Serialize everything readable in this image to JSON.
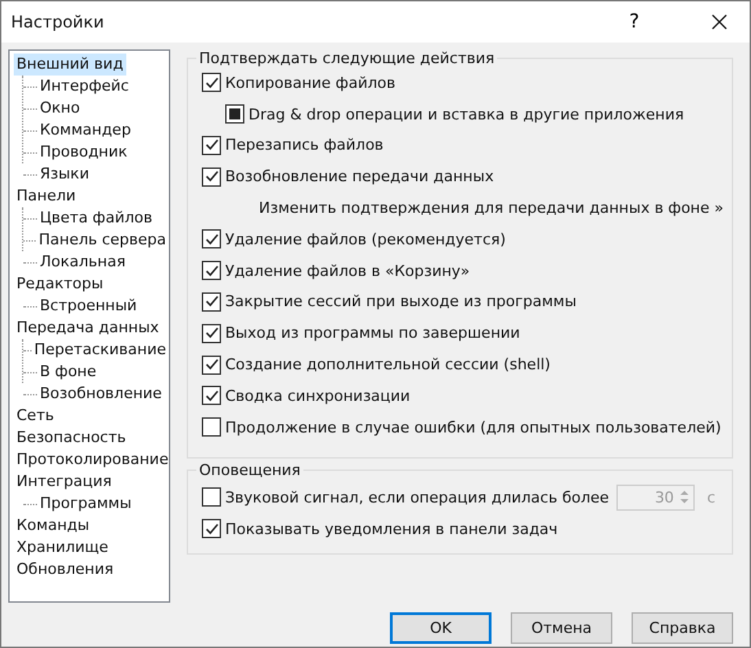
{
  "window": {
    "title": "Настройки",
    "help_button": "?"
  },
  "tree": [
    {
      "label": "Внешний вид",
      "selected": true,
      "children": [
        {
          "label": "Интерфейс",
          "selected": false
        },
        {
          "label": "Окно",
          "selected": false
        },
        {
          "label": "Коммандер",
          "selected": false
        },
        {
          "label": "Проводник",
          "selected": false
        },
        {
          "label": "Языки",
          "selected": false
        }
      ]
    },
    {
      "label": "Панели",
      "selected": false,
      "children": [
        {
          "label": "Цвета файлов",
          "selected": false
        },
        {
          "label": "Панель сервера",
          "selected": false
        },
        {
          "label": "Локальная",
          "selected": false
        }
      ]
    },
    {
      "label": "Редакторы",
      "selected": false,
      "children": [
        {
          "label": "Встроенный",
          "selected": false
        }
      ]
    },
    {
      "label": "Передача данных",
      "selected": false,
      "children": [
        {
          "label": "Перетаскивание",
          "selected": false
        },
        {
          "label": "В фоне",
          "selected": false
        },
        {
          "label": "Возобновление",
          "selected": false
        }
      ]
    },
    {
      "label": "Сеть",
      "selected": false
    },
    {
      "label": "Безопасность",
      "selected": false
    },
    {
      "label": "Протоколирование",
      "selected": false
    },
    {
      "label": "Интеграция",
      "selected": false,
      "children": [
        {
          "label": "Программы",
          "selected": false
        }
      ]
    },
    {
      "label": "Команды",
      "selected": false
    },
    {
      "label": "Хранилище",
      "selected": false
    },
    {
      "label": "Обновления",
      "selected": false
    }
  ],
  "confirm_group": {
    "title": "Подтверждать следующие действия",
    "items": [
      {
        "kind": "checkbox",
        "label": "Копирование файлов",
        "checked": true
      },
      {
        "kind": "sub-checkbox",
        "label": "Drag & drop операции и вставка в другие приложения",
        "checked": true
      },
      {
        "kind": "checkbox",
        "label": "Перезапись файлов",
        "checked": true
      },
      {
        "kind": "checkbox",
        "label": "Возобновление передачи данных",
        "checked": true
      },
      {
        "kind": "link",
        "label": "Изменить подтверждения для передачи данных в фоне »"
      },
      {
        "kind": "checkbox",
        "label": "Удаление файлов (рекомендуется)",
        "checked": true
      },
      {
        "kind": "checkbox",
        "label": "Удаление файлов в «Корзину»",
        "checked": true
      },
      {
        "kind": "checkbox",
        "label": "Закрытие сессий при выходе из программы",
        "checked": true
      },
      {
        "kind": "checkbox",
        "label": "Выход из программы по завершении",
        "checked": true
      },
      {
        "kind": "checkbox",
        "label": "Создание дополнительной сессии (shell)",
        "checked": true
      },
      {
        "kind": "checkbox",
        "label": "Сводка синхронизации",
        "checked": true
      },
      {
        "kind": "checkbox",
        "label": "Продолжение в случае ошибки (для опытных пользователей)",
        "checked": false
      }
    ]
  },
  "notify_group": {
    "title": "Оповещения",
    "beep": {
      "label": "Звуковой сигнал, если операция длилась более",
      "checked": false,
      "spin_value": "30",
      "spin_disabled": true,
      "unit": "с"
    },
    "taskbar": {
      "label": "Показывать уведомления в панели задач",
      "checked": true
    }
  },
  "buttons": [
    {
      "label": "OK",
      "default": true
    },
    {
      "label": "Отмена",
      "default": false
    },
    {
      "label": "Справка",
      "default": false
    }
  ]
}
